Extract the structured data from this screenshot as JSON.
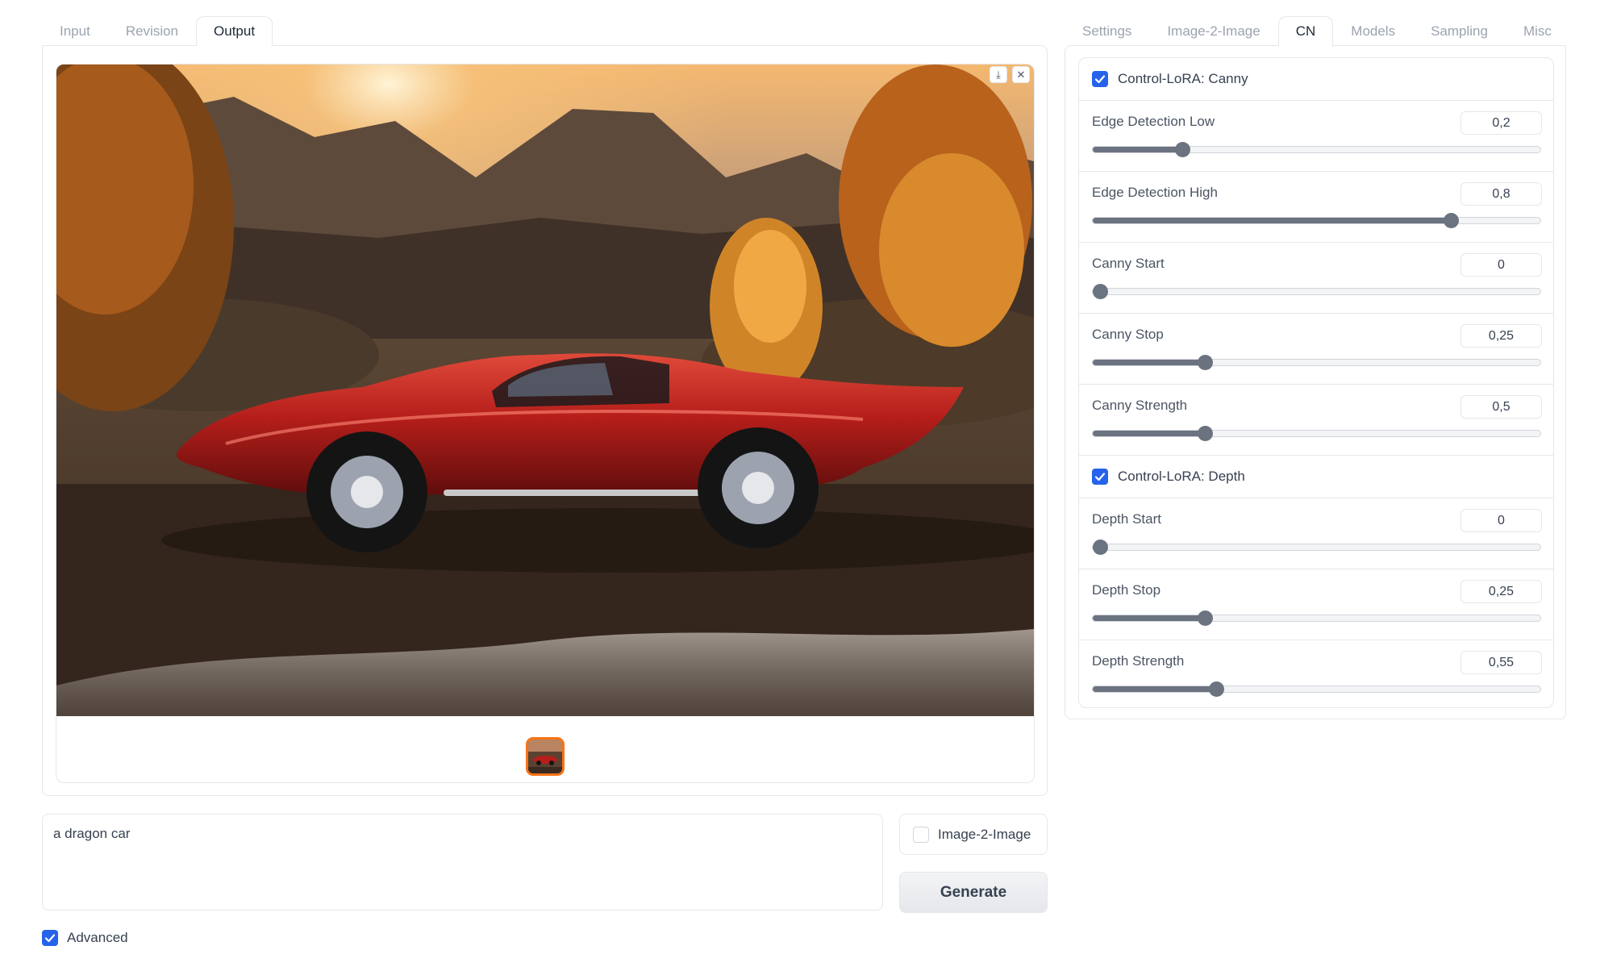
{
  "left_tabs": [
    "Input",
    "Revision",
    "Output"
  ],
  "left_active_tab": 2,
  "gallery": {
    "download_icon": "download-icon",
    "close_icon": "close-icon",
    "image_subject": "red-sports-car-in-autumn-landscape"
  },
  "prompt": {
    "value": "a dragon car"
  },
  "image2image": {
    "label": "Image-2-Image",
    "checked": false
  },
  "generate": {
    "label": "Generate"
  },
  "advanced": {
    "label": "Advanced",
    "checked": true
  },
  "right_tabs": [
    "Settings",
    "Image-2-Image",
    "CN",
    "Models",
    "Sampling",
    "Misc"
  ],
  "right_active_tab": 2,
  "cn": {
    "canny": {
      "checkbox_label": "Control-LoRA: Canny",
      "checked": true,
      "sliders": [
        {
          "label": "Edge Detection Low",
          "value": "0,2",
          "fraction": 0.2
        },
        {
          "label": "Edge Detection High",
          "value": "0,8",
          "fraction": 0.8
        },
        {
          "label": "Canny Start",
          "value": "0",
          "fraction": 0.0
        },
        {
          "label": "Canny Stop",
          "value": "0,25",
          "fraction": 0.25
        },
        {
          "label": "Canny Strength",
          "value": "0,5",
          "fraction": 0.25
        }
      ]
    },
    "depth": {
      "checkbox_label": "Control-LoRA: Depth",
      "checked": true,
      "sliders": [
        {
          "label": "Depth Start",
          "value": "0",
          "fraction": 0.0
        },
        {
          "label": "Depth Stop",
          "value": "0,25",
          "fraction": 0.25
        },
        {
          "label": "Depth Strength",
          "value": "0,55",
          "fraction": 0.275
        }
      ]
    }
  },
  "colors": {
    "accent": "#2563eb",
    "thumb_border": "#f97316",
    "slider": "#6b7280"
  }
}
